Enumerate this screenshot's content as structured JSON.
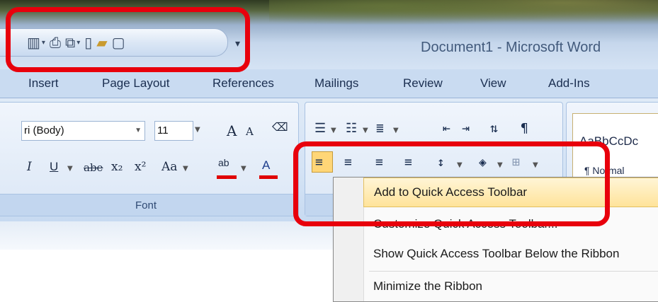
{
  "window": {
    "title": "Document1 - Microsoft Word"
  },
  "quick_access_toolbar": {
    "icons": [
      "layout-icon",
      "print-preview-icon",
      "copy-icon",
      "new-document-icon",
      "open-folder-icon",
      "blank-page-icon"
    ],
    "customize_glyph": "▾"
  },
  "ribbon": {
    "tabs": [
      "Insert",
      "Page Layout",
      "References",
      "Mailings",
      "Review",
      "View",
      "Add-Ins"
    ],
    "font": {
      "name": "ri (Body)",
      "size": "11",
      "group_label": "Font",
      "underline_label": "U",
      "strike_label": "abe",
      "case_label": "Aa",
      "grow_label": "A",
      "shrink_label": "A",
      "highlight_label": "ab",
      "color_label": "A"
    },
    "styles": {
      "sample": "AaBbCcDc",
      "normal_label": "¶ Normal"
    }
  },
  "context_menu": {
    "items": [
      "Add to Quick Access Toolbar",
      "Customize Quick Access Toolbar...",
      "Show Quick Access Toolbar Below the Ribbon",
      "Minimize the Ribbon"
    ],
    "highlighted_index": 0
  },
  "colors": {
    "accent_red": "#e8000c",
    "menu_highlight": "#ffe39a",
    "ribbon_blue": "#d4e3f5"
  }
}
